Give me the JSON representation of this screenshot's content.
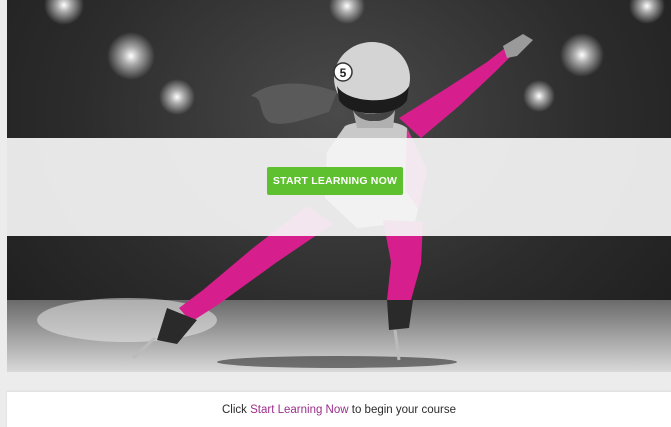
{
  "hero": {
    "image_subject": "speed skater",
    "helmet_number": "5",
    "cta_label": "START LEARNING NOW",
    "cta_color": "#5ec02e"
  },
  "instruction": {
    "prefix": "Click ",
    "link_text": "Start Learning Now",
    "suffix": " to begin your course",
    "link_color": "#9b2e8a"
  }
}
